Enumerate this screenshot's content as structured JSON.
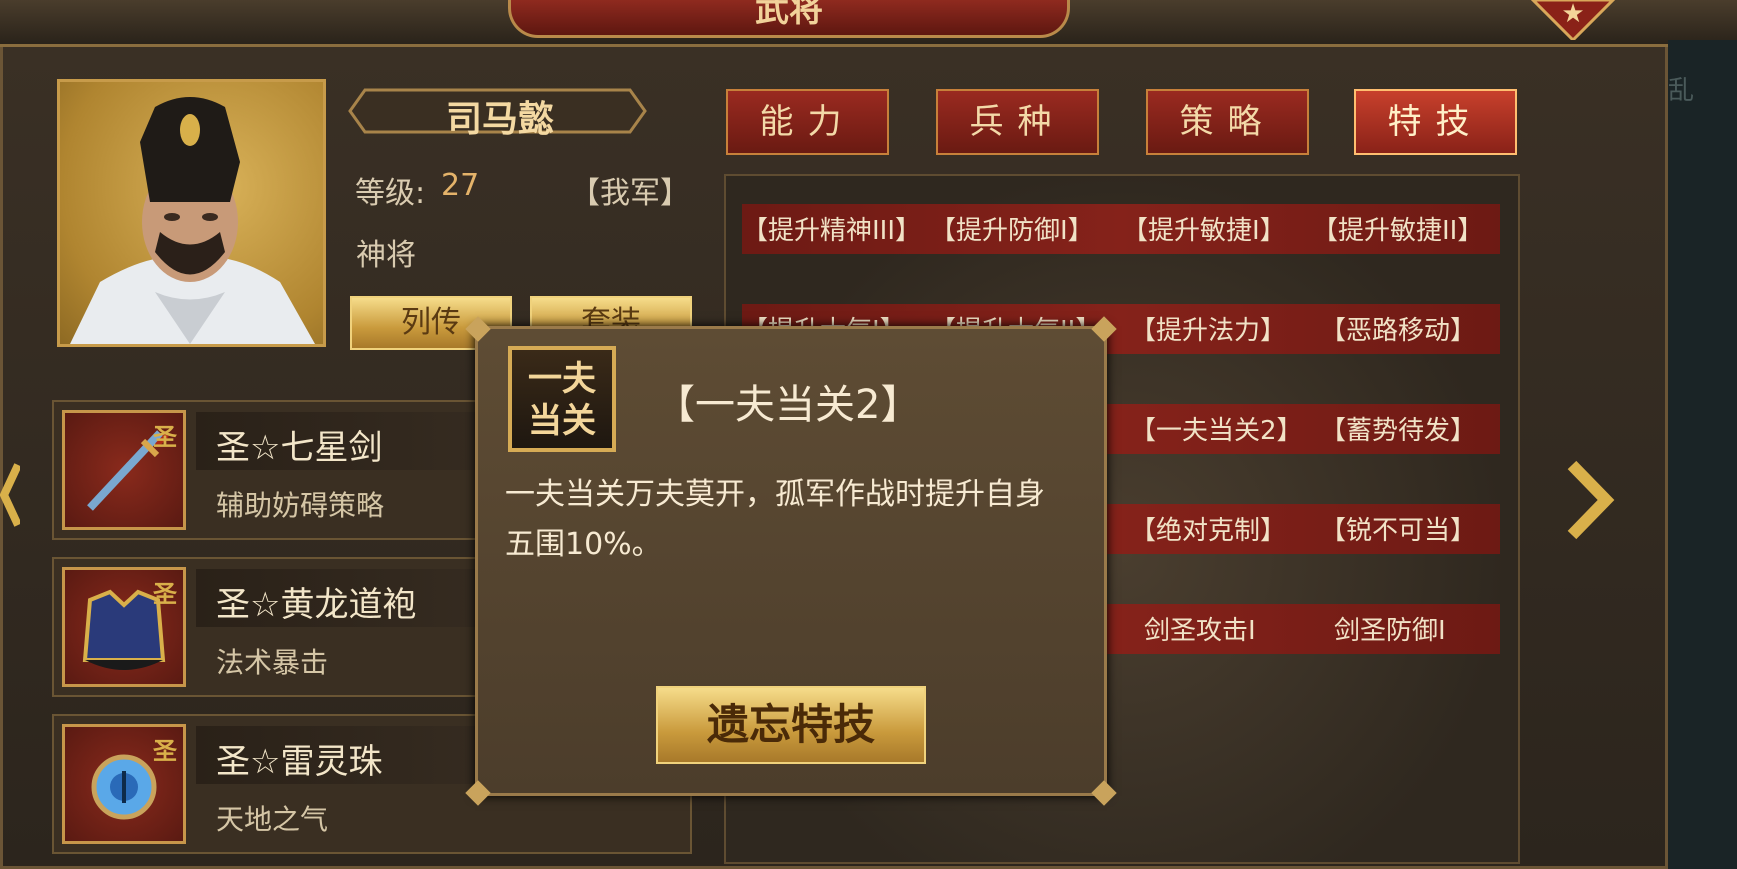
{
  "header": {
    "title": "武将"
  },
  "side_text": "乱",
  "hero": {
    "name": "司马懿",
    "level_label": "等级:",
    "level": "27",
    "faction": "【我军】",
    "rank": "神将",
    "biography_button": "列传",
    "equipment_button": "套装"
  },
  "tabs": [
    {
      "label": "能力",
      "active": false
    },
    {
      "label": "兵种",
      "active": false
    },
    {
      "label": "策略",
      "active": false
    },
    {
      "label": "特技",
      "active": true
    }
  ],
  "equipment": [
    {
      "name": "圣☆七星剑",
      "effect": "辅助妨碍策略",
      "seal": "圣"
    },
    {
      "name": "圣☆黄龙道袍",
      "effect": "法术暴击",
      "seal": "圣"
    },
    {
      "name": "圣☆雷灵珠",
      "effect": "天地之气",
      "seal": "圣"
    }
  ],
  "skill_rows": [
    [
      "【提升精神III】",
      "【提升防御Ⅰ】",
      "【提升敏捷Ⅰ】",
      "【提升敏捷II】"
    ],
    [
      "【提升士气Ⅰ】",
      "【提升士气II】",
      "【提升法力】",
      "【恶路移动】"
    ],
    [
      "",
      "",
      "【一夫当关2】",
      "【蓄势待发】"
    ],
    [
      "",
      "",
      "【绝对克制】",
      "【锐不可当】"
    ],
    [
      "",
      "",
      "剑圣攻击Ⅰ",
      "剑圣防御Ⅰ"
    ]
  ],
  "popup": {
    "icon_text_line1": "一夫",
    "icon_text_line2": "当关",
    "title": "【一夫当关2】",
    "description": "一夫当关万夫莫开，孤军作战时提升自身五围10%。",
    "forget_button": "遗忘特技"
  },
  "colors": {
    "accent_red": "#85221a",
    "gold": "#d6ab55",
    "panel": "#3a2f22"
  }
}
